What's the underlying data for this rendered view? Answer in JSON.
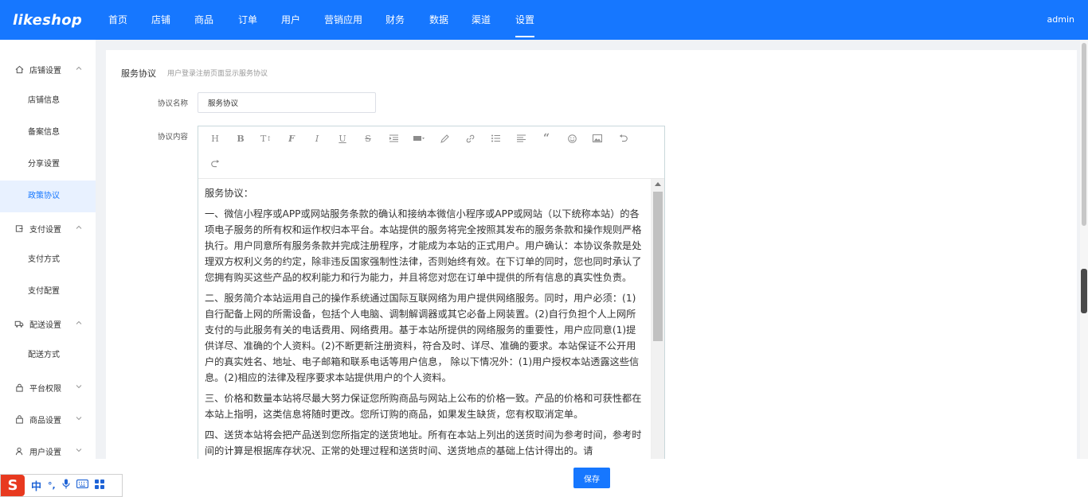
{
  "app": {
    "logo": "likeshop",
    "user": "admin"
  },
  "nav": {
    "items": [
      "首页",
      "店铺",
      "商品",
      "订单",
      "用户",
      "营销应用",
      "财务",
      "数据",
      "渠道",
      "设置"
    ],
    "active_index": 9
  },
  "sidebar": {
    "groups": [
      {
        "label": "店铺设置",
        "icon": "home-icon",
        "expanded": true,
        "items": [
          "店铺信息",
          "备案信息",
          "分享设置",
          "政策协议"
        ]
      },
      {
        "label": "支付设置",
        "icon": "payment-icon",
        "expanded": true,
        "items": [
          "支付方式",
          "支付配置"
        ]
      },
      {
        "label": "配送设置",
        "icon": "truck-icon",
        "expanded": true,
        "items": [
          "配送方式"
        ]
      },
      {
        "label": "平台权限",
        "icon": "lock-icon",
        "expanded": false,
        "items": []
      },
      {
        "label": "商品设置",
        "icon": "bag-icon",
        "expanded": false,
        "items": []
      },
      {
        "label": "用户设置",
        "icon": "user-icon",
        "expanded": false,
        "items": []
      }
    ],
    "active_item": "政策协议"
  },
  "content": {
    "section_title": "服务协议",
    "section_subtitle": "用户登录注册页面显示服务协议",
    "name_label": "协议名称",
    "name_value": "服务协议",
    "content_label": "协议内容",
    "toolbar_icons": [
      "heading-icon",
      "bold-icon",
      "font-size-icon",
      "font-family-icon",
      "italic-icon",
      "underline-icon",
      "strikethrough-icon",
      "indent-icon",
      "color-icon",
      "highlight-icon",
      "link-icon",
      "list-icon",
      "align-icon",
      "quote-icon",
      "emoji-icon",
      "image-icon",
      "undo-icon",
      "redo-icon"
    ],
    "paragraphs": [
      "服务协议：",
      "一、微信小程序或APP或网站服务条款的确认和接纳本微信小程序或APP或网站（以下统称本站）的各项电子服务的所有权和运作权归本平台。本站提供的服务将完全按照其发布的服务条款和操作规则严格执行。用户同意所有服务条款并完成注册程序，才能成为本站的正式用户。用户确认：本协议条款是处理双方权利义务的约定，除非违反国家强制性法律，否则始终有效。在下订单的同时，您也同时承认了您拥有购买这些产品的权利能力和行为能力，并且将您对您在订单中提供的所有信息的真实性负责。",
      "二、服务简介本站运用自己的操作系统通过国际互联网络为用户提供网络服务。同时，用户必须：(1)自行配备上网的所需设备，包括个人电脑、调制解调器或其它必备上网装置。(2)自行负担个人上网所支付的与此服务有关的电话费用、网络费用。基于本站所提供的网络服务的重要性，用户应同意(1)提供详尽、准确的个人资料。(2)不断更新注册资料，符合及时、详尽、准确的要求。本站保证不公开用户的真实姓名、地址、电子邮箱和联系电话等用户信息， 除以下情况外：(1)用户授权本站透露这些信息。(2)相应的法律及程序要求本站提供用户的个人资料。",
      "三、价格和数量本站将尽最大努力保证您所购商品与网站上公布的价格一致。产品的价格和可获性都在本站上指明，这类信息将随时更改。您所订购的商品，如果发生缺货，您有权取消定单。",
      "四、送货本站将会把产品送到您所指定的送货地址。所有在本站上列出的送货时间为参考时间，参考时间的计算是根据库存状况、正常的处理过程和送货时间、送货地点的基础上估计得出的。请"
    ]
  },
  "footer": {
    "save_label": "保存"
  },
  "ime": {
    "logo": "S",
    "items": [
      "中",
      "°,",
      "mic-icon",
      "keyboard-icon",
      "grid-icon"
    ]
  },
  "colors": {
    "primary": "#1677ff",
    "active_bg": "#e8f1ff"
  }
}
